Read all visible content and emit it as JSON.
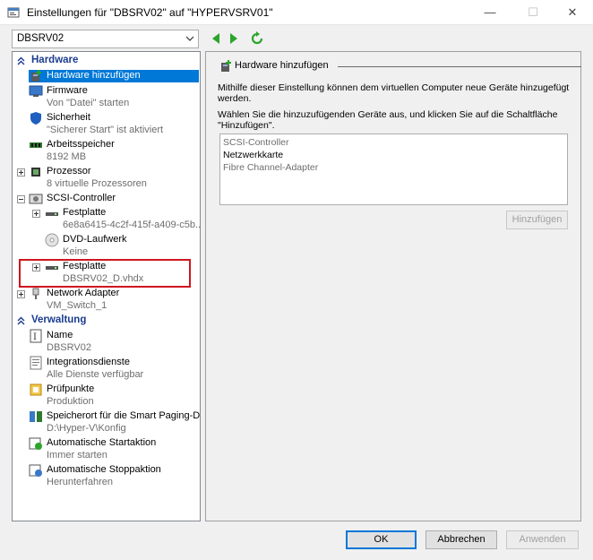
{
  "window": {
    "title": "Einstellungen für \"DBSRV02\" auf \"HYPERVSRV01\"",
    "min_glyph": "—",
    "max_glyph": "☐",
    "close_glyph": "✕"
  },
  "toolbar": {
    "vm_selected": "DBSRV02"
  },
  "tree": {
    "hardware_header": "Hardware",
    "management_header": "Verwaltung",
    "items": [
      {
        "label": "Hardware hinzufügen",
        "sub": "",
        "icon": "add-hardware-icon"
      },
      {
        "label": "Firmware",
        "sub": "Von \"Datei\" starten",
        "icon": "firmware-icon"
      },
      {
        "label": "Sicherheit",
        "sub": "\"Sicherer Start\" ist aktiviert",
        "icon": "shield-icon"
      },
      {
        "label": "Arbeitsspeicher",
        "sub": "8192 MB",
        "icon": "memory-icon"
      },
      {
        "label": "Prozessor",
        "sub": "8 virtuelle Prozessoren",
        "icon": "processor-icon"
      },
      {
        "label": "SCSI-Controller",
        "sub": "",
        "icon": "scsi-controller-icon"
      },
      {
        "label": "Festplatte",
        "sub": "6e8a6415-4c2f-415f-a409-c5b...",
        "icon": "hard-disk-icon"
      },
      {
        "label": "DVD-Laufwerk",
        "sub": "Keine",
        "icon": "dvd-drive-icon"
      },
      {
        "label": "Festplatte",
        "sub": "DBSRV02_D.vhdx",
        "icon": "hard-disk-icon"
      },
      {
        "label": "Network Adapter",
        "sub": "VM_Switch_1",
        "icon": "network-adapter-icon"
      }
    ],
    "management": [
      {
        "label": "Name",
        "sub": "DBSRV02",
        "icon": "name-icon"
      },
      {
        "label": "Integrationsdienste",
        "sub": "Alle Dienste verfügbar",
        "icon": "integration-services-icon"
      },
      {
        "label": "Prüfpunkte",
        "sub": "Produktion",
        "icon": "checkpoint-icon"
      },
      {
        "label": "Speicherort für die Smart Paging-D...",
        "sub": "D:\\Hyper-V\\Konfig",
        "icon": "smart-paging-icon"
      },
      {
        "label": "Automatische Startaktion",
        "sub": "Immer starten",
        "icon": "auto-start-icon"
      },
      {
        "label": "Automatische Stoppaktion",
        "sub": "Herunterfahren",
        "icon": "auto-stop-icon"
      }
    ]
  },
  "panel": {
    "header": "Hardware hinzufügen",
    "desc1_line1": "Mithilfe dieser Einstellung können dem virtuellen Computer neue Geräte hinzugefügt",
    "desc1_line2": "werden.",
    "desc2_line1": "Wählen Sie die hinzuzufügenden Geräte aus, und klicken Sie auf die Schaltfläche",
    "desc2_line2": "\"Hinzufügen\".",
    "devices": [
      "SCSI-Controller",
      "Netzwerkkarte",
      "Fibre Channel-Adapter"
    ],
    "add_button": "Hinzufügen"
  },
  "footer": {
    "ok": "OK",
    "cancel": "Abbrechen",
    "apply": "Anwenden"
  },
  "colors": {
    "selection": "#0078d7",
    "header_blue": "#1a3c8f",
    "highlight_red": "#d0161e",
    "nav_green": "#2aa52a"
  }
}
